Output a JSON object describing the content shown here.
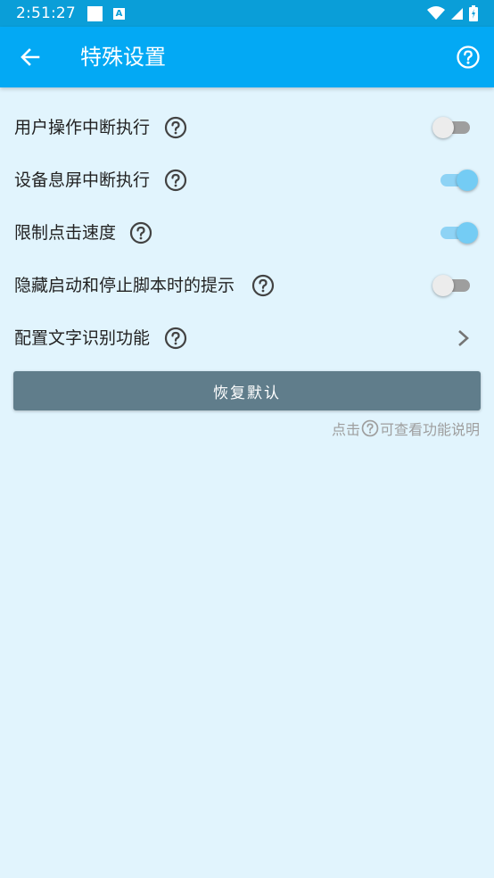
{
  "status_bar": {
    "time": "2:51:27",
    "notification_icons": [
      "square-icon",
      "a-icon"
    ],
    "system_icons": [
      "wifi-icon",
      "signal-icon",
      "battery-icon"
    ],
    "a_icon_text": "A"
  },
  "app_bar": {
    "title": "特殊设置",
    "back_icon": "arrow-left-icon",
    "help_icon": "help-circle-icon",
    "background": "#03a9f4"
  },
  "settings": [
    {
      "label": "用户操作中断执行",
      "type": "switch",
      "checked": false
    },
    {
      "label": "设备息屏中断执行",
      "type": "switch",
      "checked": true
    },
    {
      "label": "限制点击速度",
      "type": "switch",
      "checked": true
    },
    {
      "label": "隐藏启动和停止脚本时的提示",
      "type": "switch",
      "checked": false
    },
    {
      "label": "配置文字识别功能",
      "type": "link"
    }
  ],
  "reset_button": {
    "label": "恢复默认",
    "color": "#607d8b"
  },
  "hint": {
    "prefix": "点击",
    "suffix": "可查看功能说明"
  },
  "colors": {
    "page_background": "#e1f4fd",
    "switch_on": "#74ccf4",
    "switch_off": "#ececec"
  }
}
